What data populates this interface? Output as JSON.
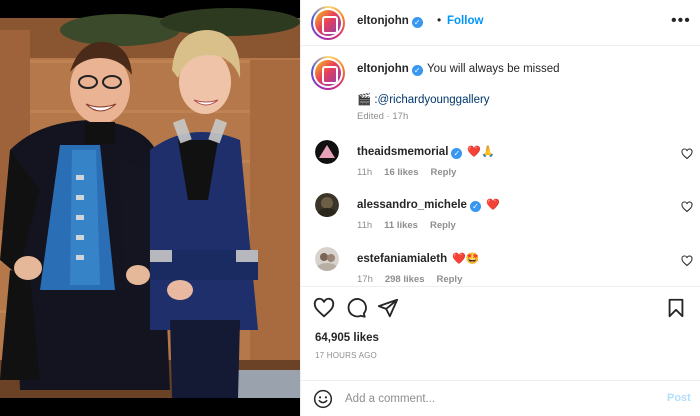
{
  "post": {
    "username": "eltonjohn",
    "verified": true,
    "follow_label": "Follow",
    "separator": "•",
    "more_label": "•••"
  },
  "caption": {
    "username": "eltonjohn",
    "text": "You will always be missed",
    "credit_emoji": "🎬",
    "credit_handle": ":@richardyounggallery",
    "edited": "Edited · 17h"
  },
  "comments": [
    {
      "username": "theaidsmemorial",
      "verified": true,
      "emoji": "❤️🙏",
      "time": "11h",
      "likes": "16 likes",
      "reply": "Reply"
    },
    {
      "username": "alessandro_michele",
      "verified": true,
      "emoji": "❤️",
      "time": "11h",
      "likes": "11 likes",
      "reply": "Reply"
    },
    {
      "username": "estefaniamialeth",
      "verified": false,
      "emoji": "❤️🤩",
      "time": "17h",
      "likes": "298 likes",
      "reply": "Reply"
    }
  ],
  "actions": {
    "likes": "64,905 likes",
    "time": "17 HOURS AGO",
    "icons": [
      "heart-icon",
      "comment-icon",
      "share-icon",
      "bookmark-icon"
    ]
  },
  "add_comment": {
    "placeholder": "Add a comment...",
    "post_label": "Post"
  },
  "colors": {
    "link": "#0095f6",
    "verified": "#3897f0",
    "heart": "#ed4956",
    "post_disabled": "#b2dffc",
    "muted": "#8e8e8e"
  }
}
